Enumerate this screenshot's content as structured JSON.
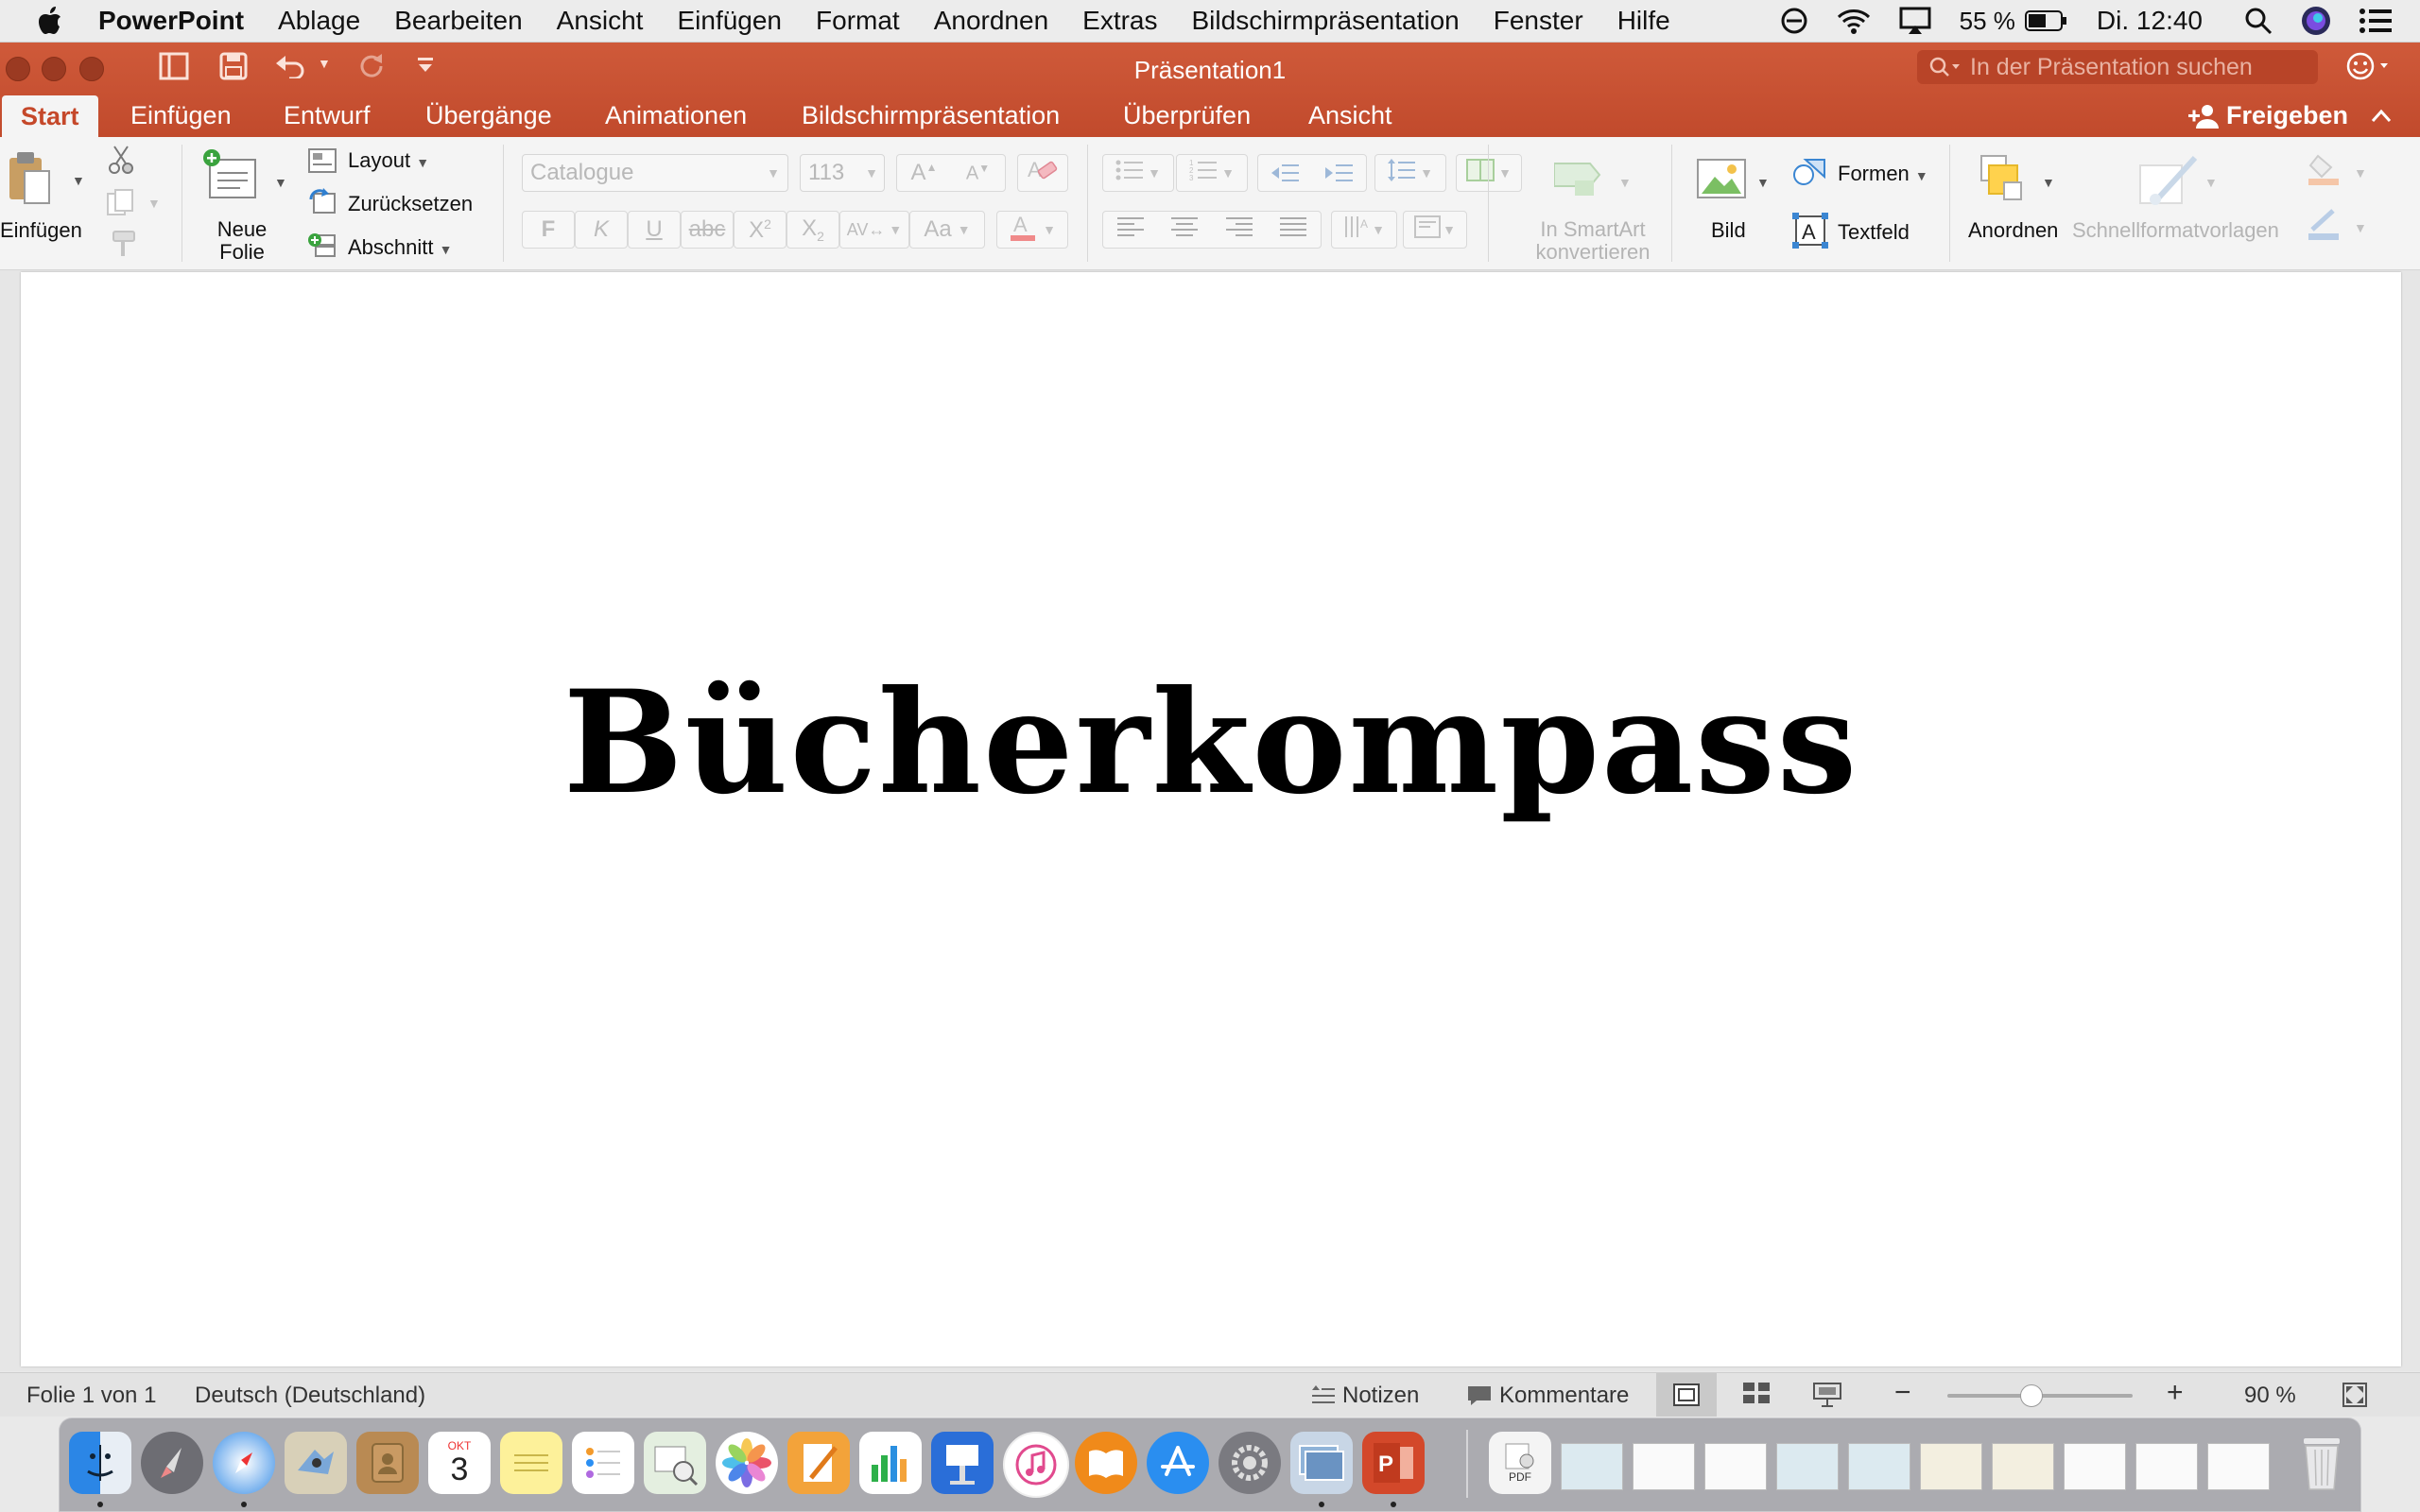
{
  "menubar": {
    "app_name": "PowerPoint",
    "items": [
      "Ablage",
      "Bearbeiten",
      "Ansicht",
      "Einfügen",
      "Format",
      "Anordnen",
      "Extras",
      "Bildschirmpräsentation",
      "Fenster",
      "Hilfe"
    ],
    "battery": "55 %",
    "clock": "Di. 12:40",
    "status_icons": [
      "do-not-disturb-icon",
      "wifi-icon",
      "airplay-icon",
      "battery-icon",
      "spotlight-icon",
      "siri-icon",
      "notification-center-icon"
    ]
  },
  "window": {
    "title": "Präsentation1",
    "search_placeholder": "In der Präsentation suchen",
    "share_label": "Freigeben",
    "accent": "#c94f30"
  },
  "tabs": [
    "Start",
    "Einfügen",
    "Entwurf",
    "Übergänge",
    "Animationen",
    "Bildschirmpräsentation",
    "Überprüfen",
    "Ansicht"
  ],
  "ribbon": {
    "paste_label": "Einfügen",
    "new_slide_label": "Neue\nFolie",
    "new_slide_line1": "Neue",
    "new_slide_line2": "Folie",
    "layout_label": "Layout",
    "reset_label": "Zurücksetzen",
    "section_label": "Abschnitt",
    "font_name": "Catalogue",
    "font_size": "113",
    "bold": "F",
    "italic": "K",
    "underline": "U",
    "strikethrough": "abc",
    "smartart_line1": "In SmartArt",
    "smartart_line2": "konvertieren",
    "picture_label": "Bild",
    "shapes_label": "Formen",
    "textbox_label": "Textfeld",
    "arrange_label": "Anordnen",
    "quick_styles_label": "Schnellformatvorlagen"
  },
  "slide": {
    "title_text": "Bücherkompass"
  },
  "statusbar": {
    "slide_info": "Folie 1 von 1",
    "language": "Deutsch (Deutschland)",
    "notes_label": "Notizen",
    "comments_label": "Kommentare",
    "zoom_minus": "−",
    "zoom_plus": "+",
    "zoom_level": "90 %",
    "zoom_fraction": 0.45
  },
  "dock": {
    "apps": [
      "Finder",
      "Launchpad",
      "Safari",
      "Mail",
      "Kontakte",
      "Kalender",
      "Notizen",
      "Erinnerungen",
      "Vorschau",
      "Fotos",
      "Pages",
      "Numbers",
      "Keynote",
      "iTunes",
      "iBooks",
      "App Store",
      "Systemeinstellungen",
      "Vorschau-Bilder",
      "PowerPoint"
    ],
    "calendar_month": "OKT",
    "calendar_day": "3",
    "pdf_label": "PDF"
  }
}
